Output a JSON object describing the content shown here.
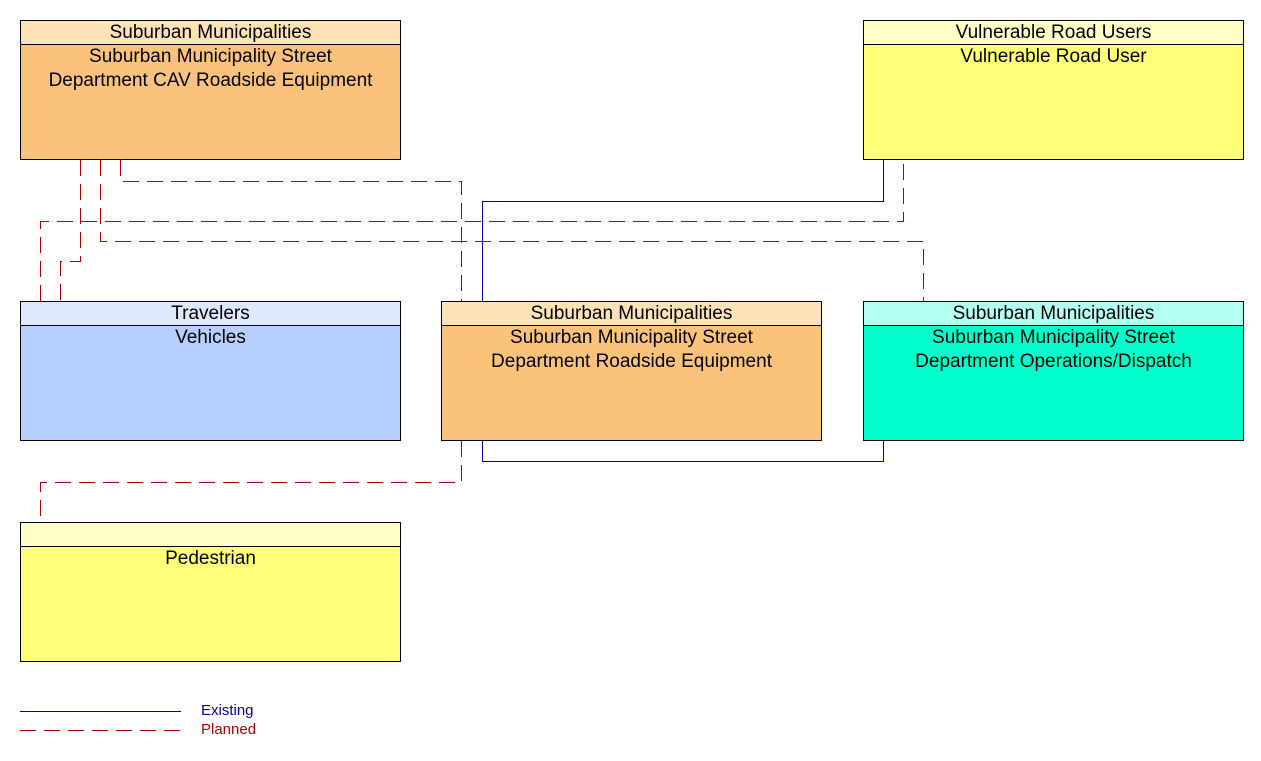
{
  "colors": {
    "existing": "#0000a8",
    "planned": "#b00000",
    "orange_header": "#fde2b6",
    "orange_body": "#fbc27c",
    "yellow_header": "#ffffc6",
    "yellow_body": "#ffff7a",
    "blue_header": "#dde9ff",
    "blue_body": "#b6cfff",
    "teal_header": "#b3fff2",
    "teal_body": "#00ffcc"
  },
  "nodes": [
    {
      "id": "cav_rse",
      "group": "Suburban Municipalities",
      "name_lines": [
        "Suburban Municipality Street",
        "Department CAV Roadside Equipment"
      ]
    },
    {
      "id": "vru",
      "group": "Vulnerable Road Users",
      "name_lines": [
        "Vulnerable Road User"
      ]
    },
    {
      "id": "vehicles",
      "group": "Travelers",
      "name_lines": [
        "Vehicles"
      ]
    },
    {
      "id": "rse",
      "group": "Suburban Municipalities",
      "name_lines": [
        "Suburban Municipality Street",
        "Department Roadside Equipment"
      ]
    },
    {
      "id": "ops",
      "group": "Suburban Municipalities",
      "name_lines": [
        "Suburban Municipality Street",
        "Department Operations/Dispatch"
      ]
    },
    {
      "id": "pedestrian",
      "group": "",
      "name_lines": [
        "Pedestrian"
      ]
    }
  ],
  "connections": [
    {
      "from": "cav_rse",
      "to": "rse",
      "status": "Planned"
    },
    {
      "from": "cav_rse",
      "to": "vehicles",
      "status": "Planned"
    },
    {
      "from": "cav_rse",
      "to": "ops",
      "status": "Planned"
    },
    {
      "from": "vehicles",
      "to": "vru",
      "status": "Planned"
    },
    {
      "from": "rse",
      "to": "vru",
      "status": "Existing"
    },
    {
      "from": "rse",
      "to": "ops",
      "status": "Existing"
    },
    {
      "from": "rse",
      "to": "pedestrian",
      "status": "Planned"
    }
  ],
  "legend": {
    "existing_label": "Existing",
    "planned_label": "Planned"
  }
}
